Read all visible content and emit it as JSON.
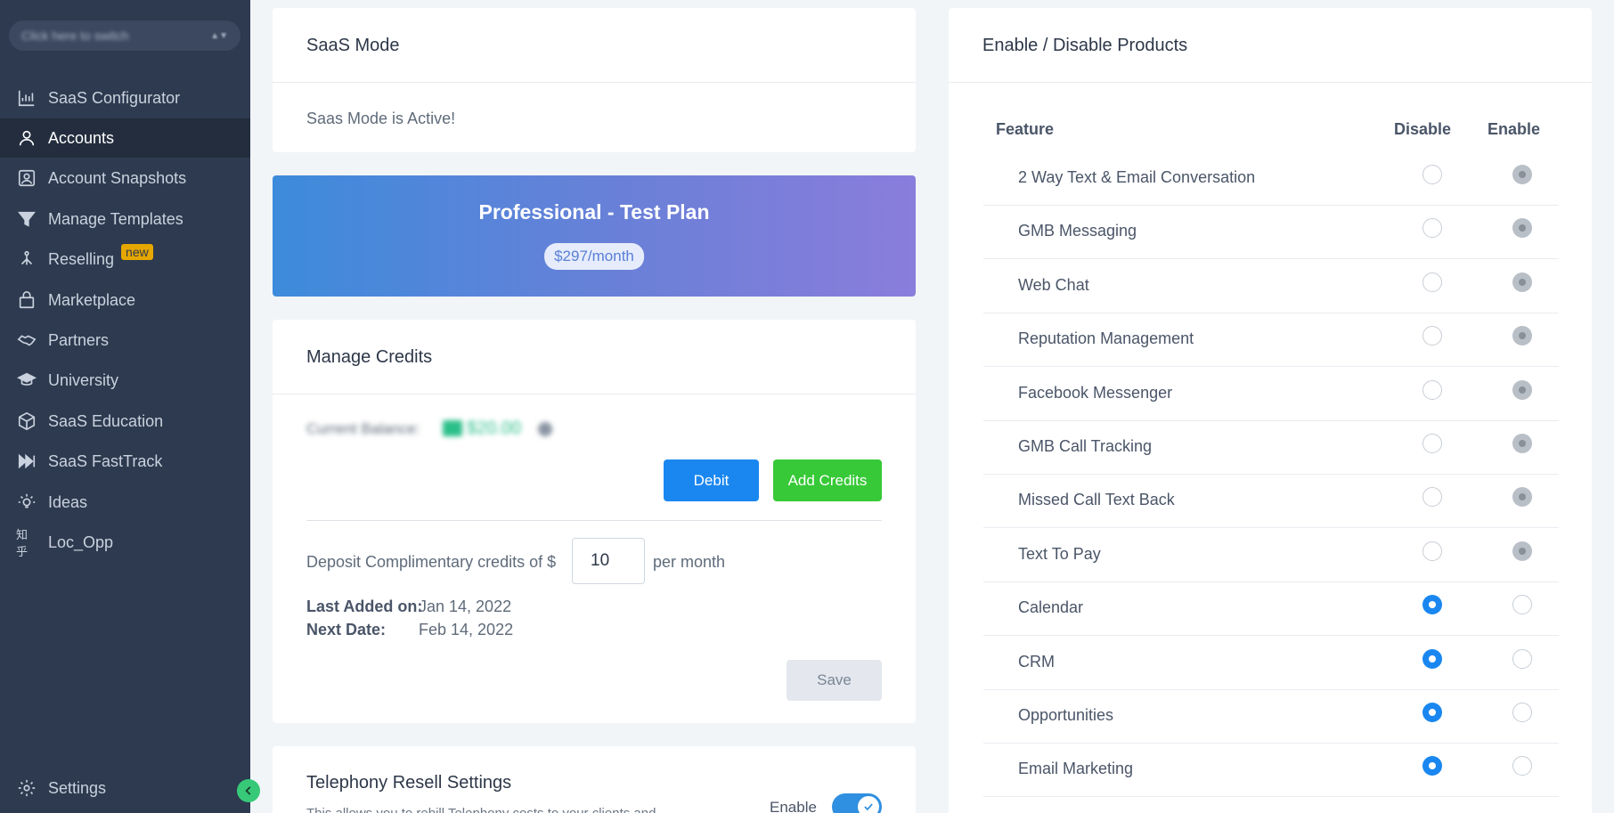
{
  "sidebar": {
    "switcher_text": "Click here to switch",
    "items": [
      {
        "label": "SaaS Configurator",
        "icon": "bar-chart-icon"
      },
      {
        "label": "Accounts",
        "icon": "user-icon",
        "active": true
      },
      {
        "label": "Account Snapshots",
        "icon": "snapshot-icon"
      },
      {
        "label": "Manage Templates",
        "icon": "filter-icon"
      },
      {
        "label": "Reselling",
        "icon": "network-icon",
        "badge": "new"
      },
      {
        "label": "Marketplace",
        "icon": "bag-icon"
      },
      {
        "label": "Partners",
        "icon": "handshake-icon"
      },
      {
        "label": "University",
        "icon": "graduation-cap-icon"
      },
      {
        "label": "SaaS Education",
        "icon": "box-icon"
      },
      {
        "label": "SaaS FastTrack",
        "icon": "fast-forward-icon"
      },
      {
        "label": "Ideas",
        "icon": "lightbulb-icon"
      },
      {
        "label": "Loc_Opp",
        "icon": "text-logo-icon"
      }
    ],
    "loc_opp_icon_text": "知乎",
    "settings_label": "Settings"
  },
  "saas_mode": {
    "title": "SaaS Mode",
    "status": "Saas Mode is Active!"
  },
  "plan": {
    "name": "Professional - Test Plan",
    "price": "$297/month"
  },
  "credits": {
    "title": "Manage Credits",
    "balance_label": "Current Balance:",
    "balance_value": "$20.00",
    "debit_label": "Debit",
    "add_label": "Add Credits",
    "deposit_prefix": "Deposit Complimentary credits of $",
    "deposit_value": "10",
    "deposit_suffix": "per month",
    "last_added_label": "Last Added on:",
    "last_added_value": "Jan 14, 2022",
    "next_date_label": "Next Date:",
    "next_date_value": "Feb 14, 2022",
    "save_label": "Save"
  },
  "telephony": {
    "title": "Telephony Resell Settings",
    "desc": "This allows you to rebill Telephony costs to your clients and",
    "enable_label": "Enable"
  },
  "products": {
    "title": "Enable / Disable Products",
    "col_feature": "Feature",
    "col_disable": "Disable",
    "col_enable": "Enable",
    "rows": [
      {
        "feature": "2 Way Text & Email Conversation",
        "state": "enable"
      },
      {
        "feature": "GMB Messaging",
        "state": "enable"
      },
      {
        "feature": "Web Chat",
        "state": "enable"
      },
      {
        "feature": "Reputation Management",
        "state": "enable"
      },
      {
        "feature": "Facebook Messenger",
        "state": "enable"
      },
      {
        "feature": "GMB Call Tracking",
        "state": "enable"
      },
      {
        "feature": "Missed Call Text Back",
        "state": "enable"
      },
      {
        "feature": "Text To Pay",
        "state": "enable"
      },
      {
        "feature": "Calendar",
        "state": "disable"
      },
      {
        "feature": "CRM",
        "state": "disable"
      },
      {
        "feature": "Opportunities",
        "state": "disable"
      },
      {
        "feature": "Email Marketing",
        "state": "disable"
      }
    ]
  },
  "colors": {
    "sidebar_bg": "#2e3a4f",
    "debit": "#1a87f0",
    "add_credits": "#37c937",
    "radio_selected": "#1a87f0"
  }
}
